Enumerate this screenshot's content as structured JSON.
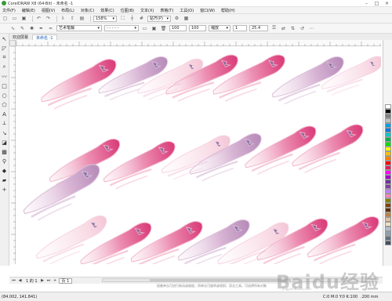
{
  "window": {
    "title": "CorelDRAW X8 (64-Bit) - 未命名 -1"
  },
  "menu": [
    "文件(F)",
    "编辑(E)",
    "视图(V)",
    "布局(L)",
    "对象(C)",
    "效果(C)",
    "位图(B)",
    "文本(X)",
    "表格(T)",
    "工具(O)",
    "窗口(W)",
    "帮助(H)"
  ],
  "toolbar": {
    "zoom": "158%",
    "snap": "贴齐(P)"
  },
  "propbar": {
    "brush": "艺术笔触",
    "angle": "100",
    "stroke": "100",
    "type": "缩放",
    "val1": "1",
    "val2": "25.4"
  },
  "tabs": [
    {
      "label": "欢迎屏幕"
    },
    {
      "label": "未命名 -1"
    }
  ],
  "pager": {
    "count": "1 的 1",
    "page": "页 1"
  },
  "status": {
    "coords": "(84.002, 141.841)",
    "hint": "接着单击可进行拖动或缩放；再单击可旋转或倾斜；双击工具，可选择所有对象",
    "fill": "C:0 M:0 Y:0 K:100",
    "stroke": ".200 mm"
  },
  "watermark": {
    "text": "Baidu经验",
    "sub": "jingyan.baidu.com"
  },
  "colors": {
    "pink_dark": "#d93a78",
    "pink": "#ec8fb2",
    "lavender": "#c8a0c8",
    "light": "#f6d3e2"
  },
  "palette": [
    "#ffffff",
    "#000000",
    "#808080",
    "#c0c0c0",
    "#00a0e8",
    "#0078d7",
    "#00c8c8",
    "#00b050",
    "#00e000",
    "#ffff00",
    "#ffc000",
    "#ff8000",
    "#ff0000",
    "#e01e5a",
    "#ff00ff",
    "#a000c0",
    "#7030a0",
    "#8040a0",
    "#c080ff",
    "#ff80c0",
    "#808000",
    "#804000",
    "#603000",
    "#c08040",
    "#e0c0a0",
    "#f0e0c0",
    "#b0c0d0",
    "#90a0b0",
    "#607080",
    "#405060"
  ]
}
